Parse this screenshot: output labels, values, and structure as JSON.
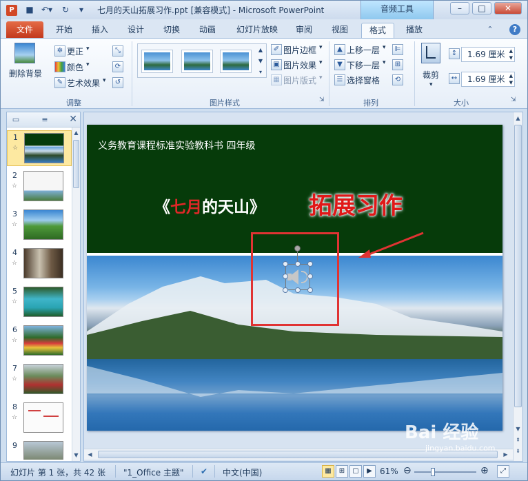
{
  "app": {
    "doc_title": "七月的天山拓展习作.ppt [兼容模式]  -  Microsoft PowerPoint",
    "contextual_tab_title": "音频工具",
    "file_tab": "文件",
    "tabs": [
      "开始",
      "插入",
      "设计",
      "切换",
      "动画",
      "幻灯片放映",
      "审阅",
      "视图",
      "格式",
      "播放"
    ]
  },
  "ribbon": {
    "remove_bg": "删除背景",
    "adjust": {
      "corrections": "更正",
      "color": "颜色",
      "artistic": "艺术效果",
      "label": "调整"
    },
    "picture_styles": {
      "border": "图片边框",
      "effects": "图片效果",
      "layout": "图片版式",
      "label": "图片样式"
    },
    "arrange": {
      "bring_forward": "上移一层",
      "send_backward": "下移一层",
      "selection_pane": "选择窗格",
      "label": "排列"
    },
    "size": {
      "crop": "裁剪",
      "height": "1.69 厘米",
      "width": "1.69 厘米",
      "label": "大小"
    }
  },
  "slides_panel": {
    "numbers": [
      "1",
      "2",
      "3",
      "4",
      "5",
      "6",
      "7",
      "8",
      "9"
    ],
    "star": "☆"
  },
  "slide": {
    "header": "义务教育课程标准实验教科书    四年级",
    "title_open": "《",
    "title_red": "七月",
    "title_rest": "的天山》",
    "title_right": "拓展习作"
  },
  "status": {
    "slide_info": "幻灯片 第 1 张，共 42 张",
    "theme": "\"1_Office 主题\"",
    "language": "中文(中国)",
    "zoom": "61%",
    "zoom_fraction": 0.61
  },
  "watermark": {
    "main": "Bai 经验",
    "sub": "jingyan.baidu.com"
  },
  "colors": {
    "slide_bg": "#063b0a",
    "title_red": "#e01818",
    "file_tab": "#d24726",
    "selection": "#e03333"
  }
}
